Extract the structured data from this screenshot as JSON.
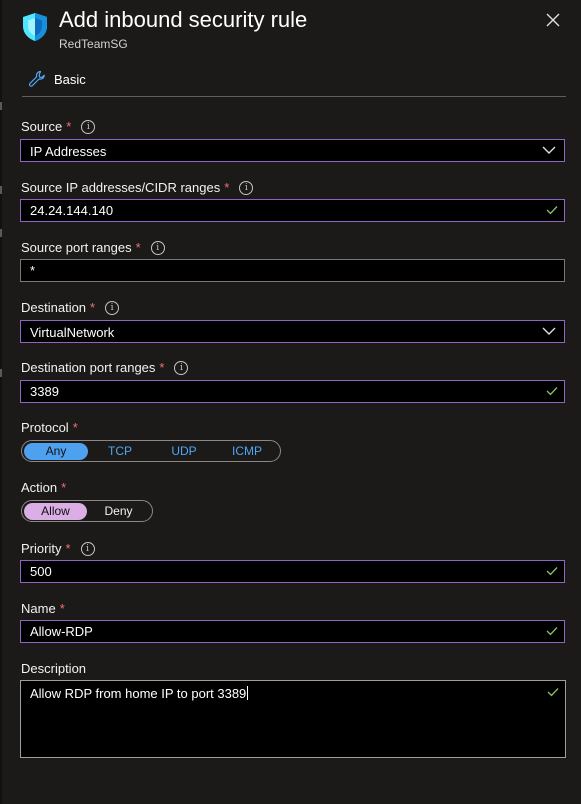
{
  "header": {
    "title": "Add inbound security rule",
    "subtitle": "RedTeamSG",
    "close_icon": "close-icon",
    "shield_icon": "shield-icon"
  },
  "tabs": [
    {
      "label": "Basic",
      "icon": "wrench-icon"
    }
  ],
  "required_marker": "*",
  "form": {
    "source": {
      "label": "Source",
      "value": "IP Addresses"
    },
    "source_ip": {
      "label": "Source IP addresses/CIDR ranges",
      "value": "24.24.144.140"
    },
    "source_port": {
      "label": "Source port ranges",
      "value": "*"
    },
    "destination": {
      "label": "Destination",
      "value": "VirtualNetwork"
    },
    "destination_port": {
      "label": "Destination port ranges",
      "value": "3389"
    },
    "protocol": {
      "label": "Protocol",
      "options": [
        "Any",
        "TCP",
        "UDP",
        "ICMP"
      ],
      "selected": "Any"
    },
    "action": {
      "label": "Action",
      "options": [
        "Allow",
        "Deny"
      ],
      "selected": "Allow"
    },
    "priority": {
      "label": "Priority",
      "value": "500"
    },
    "name": {
      "label": "Name",
      "value": "Allow-RDP"
    },
    "description": {
      "label": "Description",
      "value": "Allow RDP from home IP to port 3389"
    }
  },
  "colors": {
    "background": "#1b1a19",
    "field_border_purple": "#9064c4",
    "required": "#f1707b",
    "valid_check": "#8cbf6f",
    "toggle_blue": "#4ea1ef",
    "toggle_pink": "#dbaee6",
    "link_blue": "#4ea6f5"
  }
}
